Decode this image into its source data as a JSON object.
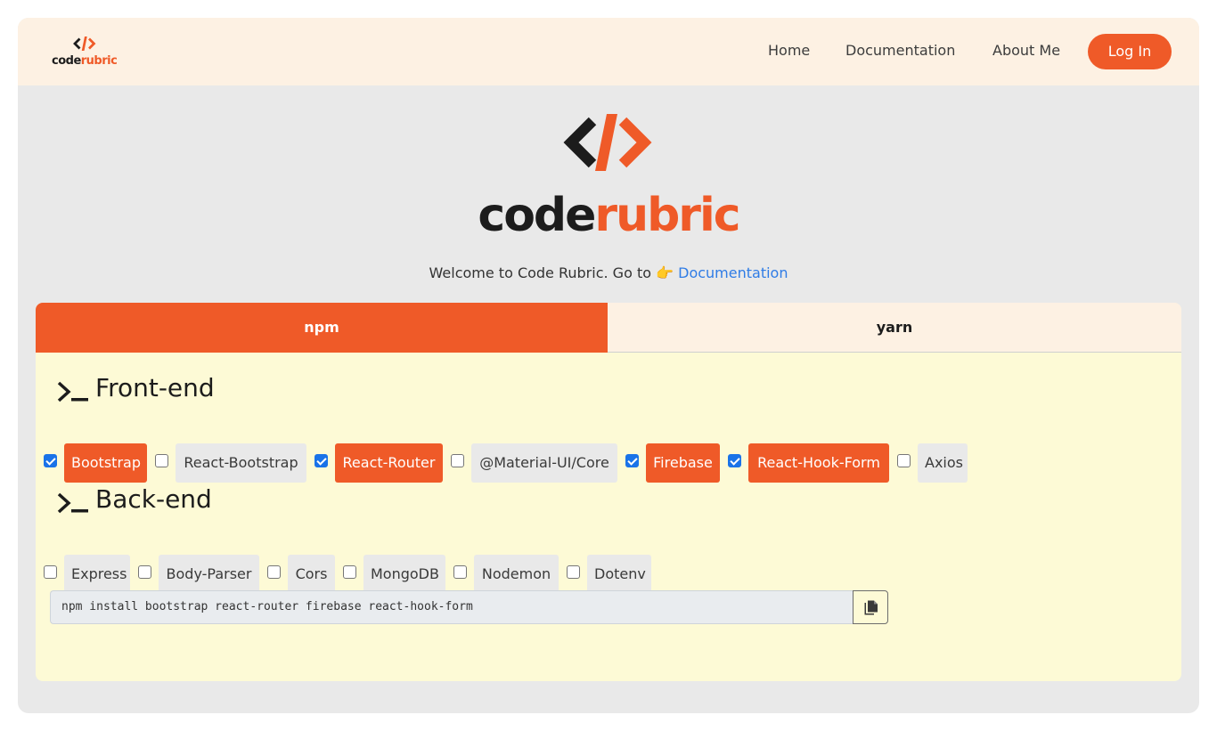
{
  "navbar": {
    "logo_text_dark": "code",
    "logo_text_accent": "rubric",
    "links": [
      "Home",
      "Documentation",
      "About Me"
    ],
    "login_label": "Log In"
  },
  "hero": {
    "brand_dark": "code",
    "brand_accent": "rubric",
    "welcome_text": "Welcome to Code Rubric. Go to",
    "pointer_icon": "👉",
    "doc_link": "Documentation"
  },
  "tabs": [
    {
      "label": "npm",
      "active": true
    },
    {
      "label": "yarn",
      "active": false
    }
  ],
  "frontend": {
    "title": "Front-end",
    "packages": [
      {
        "label": "Bootstrap",
        "checked": true
      },
      {
        "label": "React-Bootstrap",
        "checked": false
      },
      {
        "label": "React-Router",
        "checked": true
      },
      {
        "label": "@Material-UI/Core",
        "checked": false
      },
      {
        "label": "Firebase",
        "checked": true
      },
      {
        "label": "React-Hook-Form",
        "checked": true
      },
      {
        "label": "Axios",
        "checked": false
      }
    ]
  },
  "backend": {
    "title": "Back-end",
    "packages": [
      {
        "label": "Express",
        "checked": false
      },
      {
        "label": "Body-Parser",
        "checked": false
      },
      {
        "label": "Cors",
        "checked": false
      },
      {
        "label": "MongoDB",
        "checked": false
      },
      {
        "label": "Nodemon",
        "checked": false
      },
      {
        "label": "Dotenv",
        "checked": false
      }
    ]
  },
  "command": {
    "text": "npm install bootstrap react-router firebase react-hook-form",
    "copy_icon": "copy-icon"
  },
  "colors": {
    "accent": "#ef5a28",
    "navbar_bg": "#fdf1e3",
    "panel_bg": "#fdfad6",
    "checkbox_blue": "#1a73e8",
    "link_blue": "#2f7ce6"
  }
}
